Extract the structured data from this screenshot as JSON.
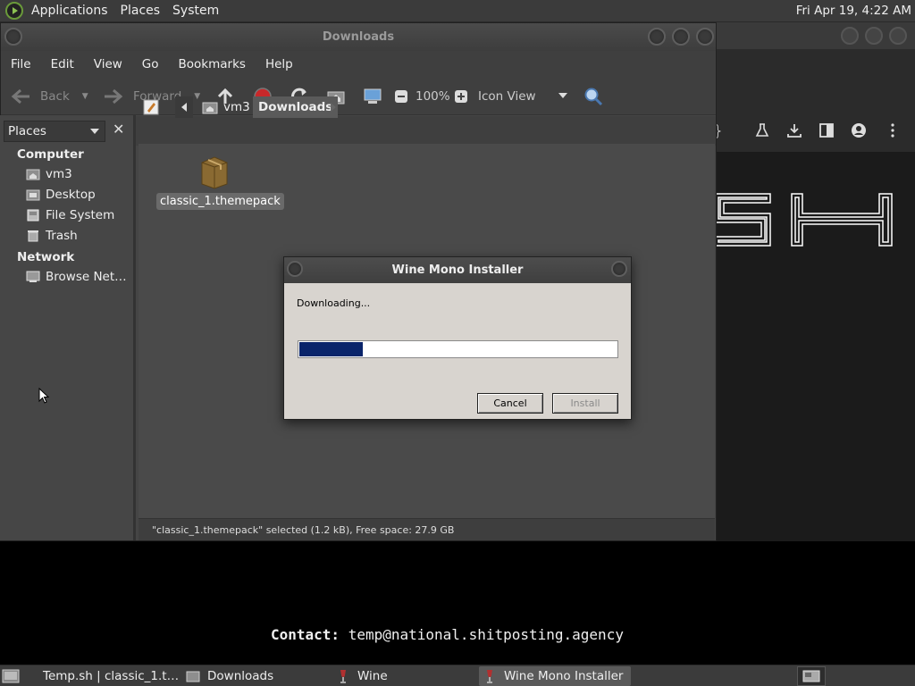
{
  "top_panel": {
    "menus": [
      "Applications",
      "Places",
      "System"
    ],
    "clock": "Fri Apr 19,  4:22 AM"
  },
  "file_manager": {
    "title": "Downloads",
    "menu": [
      "File",
      "Edit",
      "View",
      "Go",
      "Bookmarks",
      "Help"
    ],
    "toolbar": {
      "back": "Back",
      "forward": "Forward",
      "zoom": "100%",
      "view_mode": "Icon View"
    },
    "sidebar": {
      "combo": "Places",
      "computer_header": "Computer",
      "computer_items": [
        "vm3",
        "Desktop",
        "File System",
        "Trash"
      ],
      "network_header": "Network",
      "network_items": [
        "Browse Net…"
      ]
    },
    "path": [
      "vm3",
      "Downloads"
    ],
    "files": [
      {
        "name": "classic_1.themepack",
        "icon": "package-icon"
      }
    ],
    "status": "\"classic_1.themepack\" selected (1.2 kB), Free space: 27.9 GB"
  },
  "dialog": {
    "title": "Wine Mono Installer",
    "message": "Downloading...",
    "progress": 0.2,
    "cancel_label": "Cancel",
    "install_label": "Install"
  },
  "terminal": {
    "contact_label": "Contact:",
    "contact_value": "temp@national.shitposting.agency"
  },
  "taskbar": {
    "tasks": [
      {
        "label": "Temp.sh | classic_1.t…",
        "icon": "browser-icon"
      },
      {
        "label": "Downloads",
        "icon": "folder-icon"
      },
      {
        "label": "Wine",
        "icon": "wine-icon"
      },
      {
        "label": "Wine Mono Installer",
        "icon": "wine-icon",
        "active": true
      }
    ]
  },
  "colors": {
    "progress_fill": "#0a246a",
    "dialog_bg": "#d8d4cf",
    "panel_bg": "#3b3b3b"
  }
}
